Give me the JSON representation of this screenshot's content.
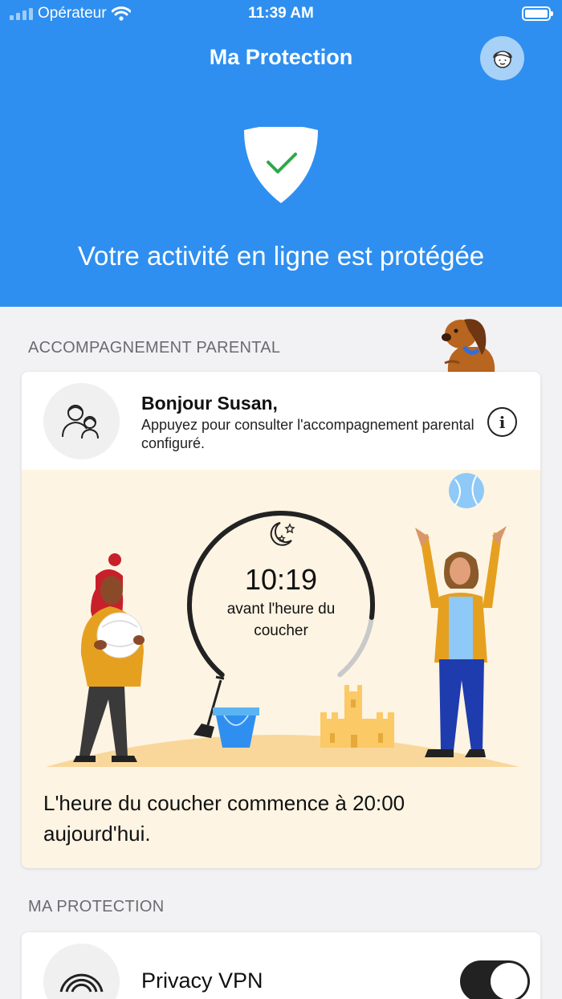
{
  "status_bar": {
    "carrier": "Opérateur",
    "time": "11:39 AM"
  },
  "header": {
    "title": "Ma Protection",
    "status_message": "Votre activité en ligne est protégée"
  },
  "sections": {
    "parental": "ACCOMPAGNEMENT PARENTAL",
    "protection": "MA PROTECTION"
  },
  "parental_card": {
    "greeting": "Bonjour Susan,",
    "subtitle": "Appuyez pour consulter l'accompagnement parental configuré.",
    "timer": {
      "time": "10:19",
      "label": "avant l'heure du coucher",
      "remaining_fraction": 0.85
    },
    "bedtime_note": "L'heure du coucher commence à 20:00 aujourd'hui."
  },
  "vpn": {
    "label": "Privacy VPN",
    "enabled": true
  },
  "colors": {
    "brand_blue": "#2e8ff0",
    "scene_background": "#fdf4e3",
    "check_green": "#2ea84a"
  },
  "icons": [
    "wifi-icon",
    "battery-icon",
    "avatar-icon",
    "shield-check-icon",
    "family-icon",
    "info-icon",
    "moon-stars-icon",
    "vpn-signal-icon"
  ]
}
